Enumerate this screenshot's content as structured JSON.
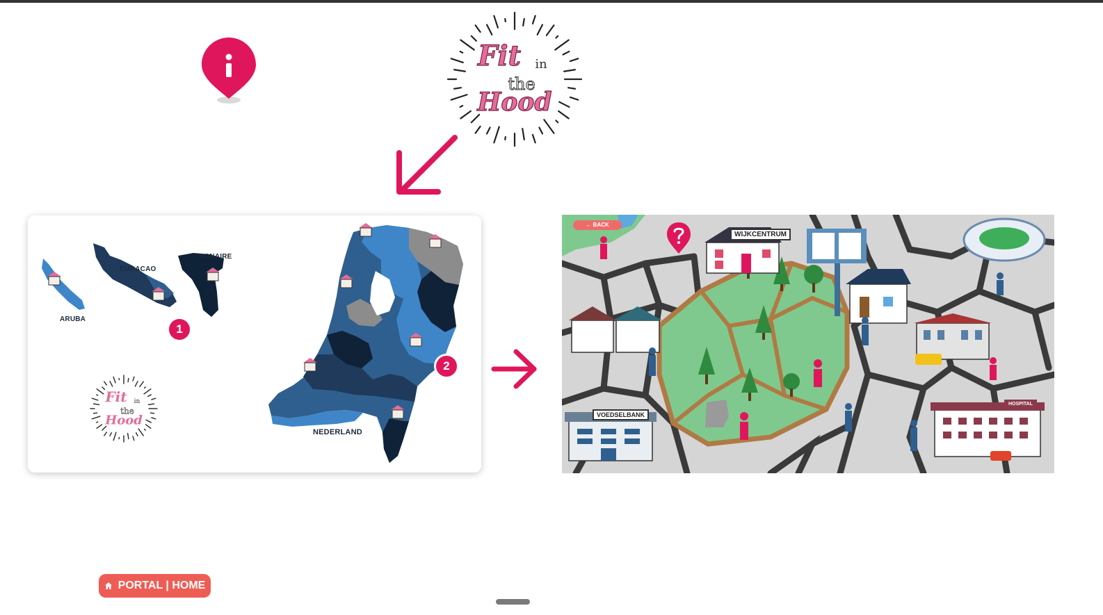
{
  "colors": {
    "accent": "#e0165c",
    "portal_button": "#ee5d55",
    "map_dark": "#1f3a5a",
    "map_mid": "#2f5f8f",
    "map_light": "#3f86c8",
    "map_gray": "#8c8c8c",
    "park_green": "#7fc98e"
  },
  "logo": {
    "line1": "Fit",
    "line2": "in",
    "line3": "the",
    "line4": "Hood"
  },
  "map_card": {
    "labels": {
      "curacao": "CURACAO",
      "bonaire": "BONAIRE",
      "aruba": "ARUBA",
      "nederland": "NEDERLAND"
    },
    "badges": [
      "1",
      "2"
    ]
  },
  "neighborhood": {
    "back_label": "← BACK",
    "signs": {
      "wijkcentrum": "WIJKCENTRUM",
      "voedselbank": "VOEDSELBANK",
      "hospital": "HOSPITAL"
    },
    "help_icon": "question-pin-icon"
  },
  "footer": {
    "portal_label": "PORTAL | HOME",
    "portal_icon": "home-icon"
  },
  "icons": {
    "info": "info-pin-icon",
    "arrow_down": "arrow-down-left-icon",
    "arrow_right": "arrow-right-icon"
  }
}
